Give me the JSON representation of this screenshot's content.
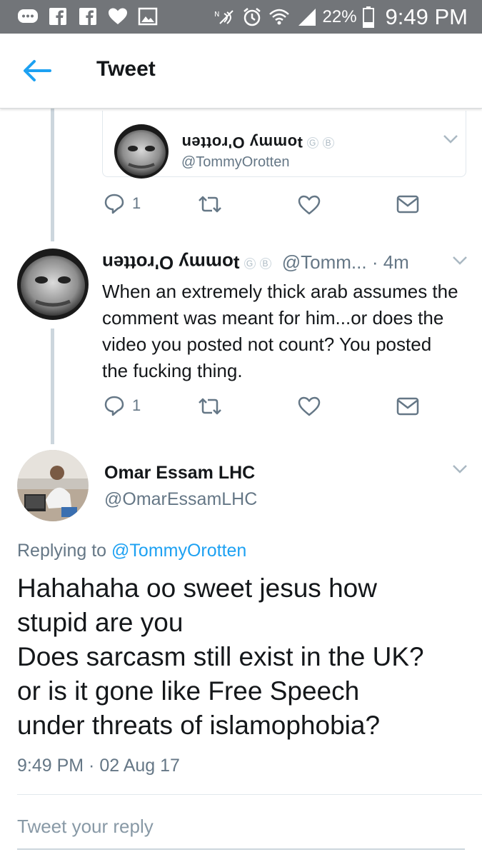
{
  "status_bar": {
    "battery": "22%",
    "time": "9:49 PM",
    "left_icons": [
      "messages-icon",
      "facebook-icon",
      "facebook-icon",
      "heart-icon",
      "gallery-icon"
    ],
    "right_icons": [
      "nfc-icon",
      "alarm-icon",
      "wifi-icon",
      "signal-icon",
      "battery-icon"
    ]
  },
  "header": {
    "title": "Tweet"
  },
  "quoted_tweet": {
    "name": "ʇommy O'rotten",
    "handle": "@TommyOrotten",
    "badges": [
      "G",
      "B"
    ],
    "reply_count": "1"
  },
  "reply_tweet": {
    "name": "ʇommy O'rotten",
    "badges": [
      "G",
      "B"
    ],
    "handle": "@Tomm...",
    "meta": "· 4m",
    "text": "When an extremely thick arab assumes the comment was meant for him...or does the video you posted not count? You posted the fucking thing.",
    "reply_count": "1"
  },
  "main_tweet": {
    "name": "Omar Essam LHC",
    "handle": "@OmarEssamLHC",
    "replying_prefix": "Replying to",
    "replying_to": "@TommyOrotten",
    "text_lines": [
      "Hahahaha oo sweet jesus how",
      "stupid are you",
      "Does sarcasm still exist in the UK?",
      "or is it gone like Free Speech",
      "under threats of islamophobia?"
    ],
    "timestamp": "9:49 PM · 02 Aug 17"
  },
  "reply_box": {
    "placeholder": "Tweet your reply"
  },
  "colors": {
    "accent": "#1da1f2",
    "status_bar": "#727579",
    "secondary_text": "#657786",
    "divider": "#e1e8ed"
  }
}
